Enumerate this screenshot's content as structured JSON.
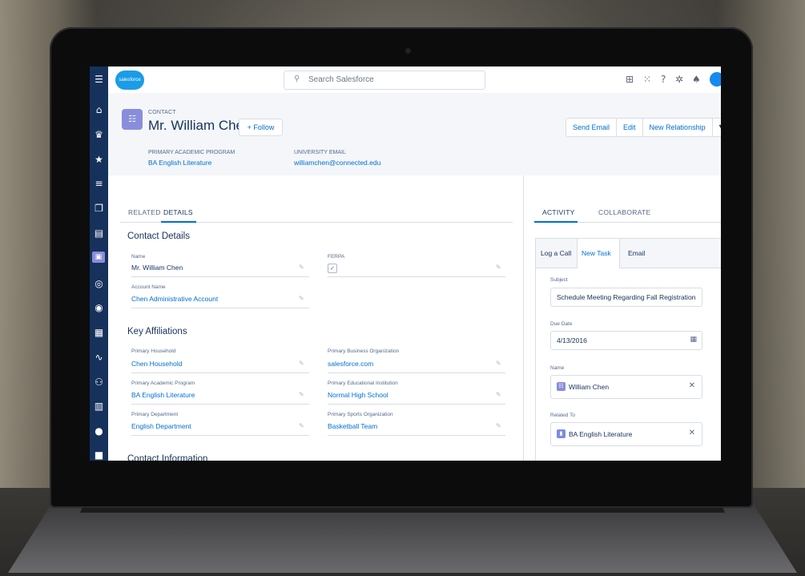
{
  "search": {
    "placeholder": "Search Salesforce"
  },
  "logo": {
    "text": "salesforce"
  },
  "record": {
    "object_type": "CONTACT",
    "name": "Mr. William Chen",
    "follow_label": "+ Follow",
    "actions": [
      "Send Email",
      "Edit",
      "New Relationship",
      "▼"
    ],
    "highlights": [
      {
        "label": "PRIMARY ACADEMIC PROGRAM",
        "value": "BA English Literature"
      },
      {
        "label": "UNIVERSITY EMAIL",
        "value": "williamchen@connected.edu"
      }
    ]
  },
  "detail_tabs": {
    "related": "RELATED",
    "details": "DETAILS"
  },
  "contact_details": {
    "heading": "Contact Details",
    "name_label": "Name",
    "name_value": "Mr. William Chen",
    "ferpa_label": "FERPA",
    "account_label": "Account Name",
    "account_value": "Chen Administrative Account"
  },
  "key_affiliations": {
    "heading": "Key Affiliations",
    "fields": [
      {
        "label": "Primary Household",
        "value": "Chen Household"
      },
      {
        "label": "Primary Business Organization",
        "value": "salesforce.com"
      },
      {
        "label": "Primary Academic Program",
        "value": "BA English Literature"
      },
      {
        "label": "Primary Educational Institution",
        "value": "Normal High School"
      },
      {
        "label": "Primary Department",
        "value": "English Department"
      },
      {
        "label": "Primary Sports Organization",
        "value": "Basketball Team"
      }
    ]
  },
  "contact_information": {
    "heading": "Contact Information"
  },
  "activity": {
    "tabs": {
      "activity": "ACTIVITY",
      "collaborate": "COLLABORATE"
    },
    "publisher_tabs": [
      "Log a Call",
      "New Task",
      "Email"
    ],
    "subject_label": "Subject",
    "subject_value": "Schedule Meeting Regarding Fall Registration",
    "due_label": "Due Date",
    "due_value": "4/13/2016",
    "name_label": "Name",
    "name_value": "William Chen",
    "related_label": "Related To",
    "related_value": "BA English Literature"
  },
  "colors": {
    "nav": "#16325c",
    "link": "#0070d2",
    "contact_icon": "#8a8ddc",
    "program_icon": "#7e8be4"
  }
}
